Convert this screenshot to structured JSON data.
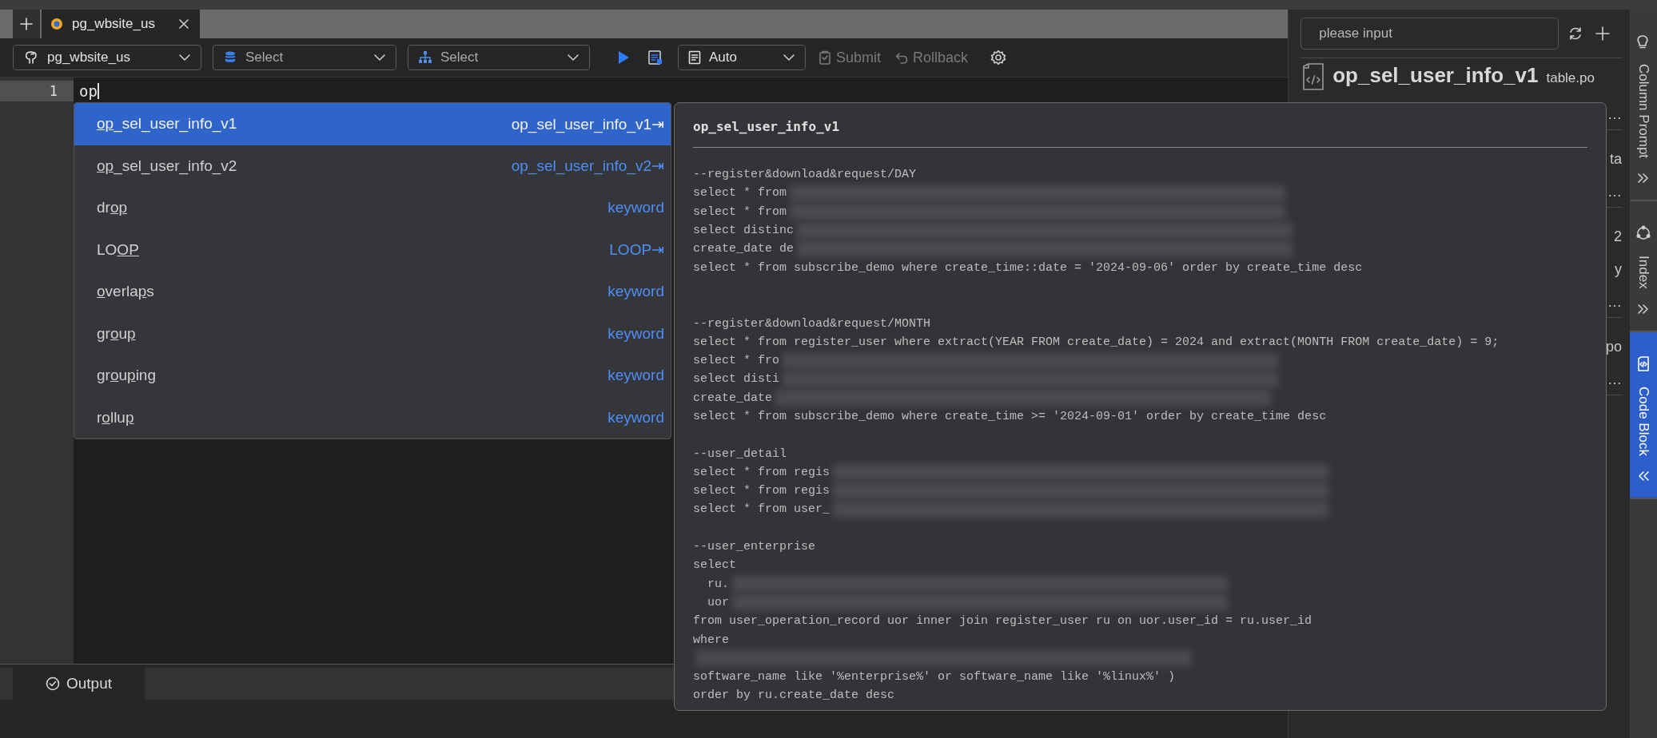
{
  "editor_tab": {
    "title": "pg_wbsite_us",
    "selected": true
  },
  "toolbar": {
    "datasource": "pg_wbsite_us",
    "database": {
      "placeholder": "Select"
    },
    "schema": {
      "placeholder": "Select"
    },
    "mode": "Auto",
    "submit": {
      "label": "Submit",
      "disabled": true
    },
    "rollback": {
      "label": "Rollback",
      "disabled": true
    }
  },
  "editor": {
    "lines": [
      {
        "number": "1",
        "text": "op"
      }
    ]
  },
  "suggestions": [
    {
      "label_parts": [
        {
          "text": "op",
          "matched": true
        },
        {
          "text": "_sel_user_info_v1",
          "matched": false
        }
      ],
      "detail": "op_sel_user_info_v1⇥",
      "selected": true
    },
    {
      "label_parts": [
        {
          "text": "op",
          "matched": true
        },
        {
          "text": "_sel_user_info_v2",
          "matched": false
        }
      ],
      "detail": "op_sel_user_info_v2⇥",
      "selected": false
    },
    {
      "label_parts": [
        {
          "text": "dr",
          "matched": false
        },
        {
          "text": "op",
          "matched": true
        }
      ],
      "detail": "keyword",
      "selected": false
    },
    {
      "label_parts": [
        {
          "text": "LO",
          "matched": false
        },
        {
          "text": "OP",
          "matched": true
        }
      ],
      "detail": "LOOP⇥",
      "selected": false
    },
    {
      "label_parts": [
        {
          "text": "o",
          "matched": true
        },
        {
          "text": "verla",
          "matched": false
        },
        {
          "text": "p",
          "matched": true
        },
        {
          "text": "s",
          "matched": false
        }
      ],
      "detail": "keyword",
      "selected": false
    },
    {
      "label_parts": [
        {
          "text": "gr",
          "matched": false
        },
        {
          "text": "o",
          "matched": true
        },
        {
          "text": "u",
          "matched": false
        },
        {
          "text": "p",
          "matched": true
        }
      ],
      "detail": "keyword",
      "selected": false
    },
    {
      "label_parts": [
        {
          "text": "gr",
          "matched": false
        },
        {
          "text": "o",
          "matched": true
        },
        {
          "text": "u",
          "matched": false
        },
        {
          "text": "p",
          "matched": true
        },
        {
          "text": "ing",
          "matched": false
        }
      ],
      "detail": "keyword",
      "selected": false
    },
    {
      "label_parts": [
        {
          "text": "r",
          "matched": false
        },
        {
          "text": "o",
          "matched": true
        },
        {
          "text": "llu",
          "matched": false
        },
        {
          "text": "p",
          "matched": true
        }
      ],
      "detail": "keyword",
      "selected": false
    }
  ],
  "code_preview": {
    "title": "op_sel_user_info_v1",
    "lines": [
      {
        "kind": "code",
        "text": "--register&download&request/DAY",
        "redacted": false
      },
      {
        "kind": "code",
        "text": "select * from",
        "redacted": true
      },
      {
        "kind": "code",
        "text": "select * from",
        "redacted": true
      },
      {
        "kind": "code",
        "text": "select distinc",
        "redacted": true
      },
      {
        "kind": "code",
        "text": "create_date de",
        "redacted": true
      },
      {
        "kind": "code",
        "text": "select * from subscribe_demo where create_time::date = '2024-09-06' order by create_time desc",
        "redacted": false
      },
      {
        "kind": "blank"
      },
      {
        "kind": "blank"
      },
      {
        "kind": "code",
        "text": "--register&download&request/MONTH",
        "redacted": false
      },
      {
        "kind": "code",
        "text": "select * from register_user where extract(YEAR FROM create_date) = 2024 and extract(MONTH FROM create_date) = 9;",
        "redacted": false
      },
      {
        "kind": "code",
        "text": "select * fro",
        "redacted": true
      },
      {
        "kind": "code",
        "text": "select disti",
        "redacted": true
      },
      {
        "kind": "code",
        "text": "create_date",
        "redacted": true
      },
      {
        "kind": "code",
        "text": "select * from subscribe_demo where create_time >= '2024-09-01' order by create_time desc",
        "redacted": false
      },
      {
        "kind": "blank"
      },
      {
        "kind": "code",
        "text": "--user_detail",
        "redacted": false
      },
      {
        "kind": "code",
        "text": "select * from regis",
        "redacted": true
      },
      {
        "kind": "code",
        "text": "select * from regis",
        "redacted": true
      },
      {
        "kind": "code",
        "text": "select * from user_",
        "redacted": true
      },
      {
        "kind": "blank"
      },
      {
        "kind": "code",
        "text": "--user_enterprise",
        "redacted": false
      },
      {
        "kind": "code",
        "text": "select",
        "redacted": false
      },
      {
        "kind": "code",
        "text": "  ru.",
        "redacted": true
      },
      {
        "kind": "code",
        "text": "  uor",
        "redacted": true
      },
      {
        "kind": "code",
        "text": "from user_operation_record uor inner join register_user ru on uor.user_id = ru.user_id",
        "redacted": false
      },
      {
        "kind": "code",
        "text": "where",
        "redacted": false
      },
      {
        "kind": "code",
        "redacted": true
      },
      {
        "kind": "code",
        "text": "software_name like '%enterprise%' or software_name like '%linux%' )",
        "redacted": false
      },
      {
        "kind": "code",
        "text": "order by ru.create_date desc",
        "redacted": false
      }
    ]
  },
  "output_tab": {
    "label": "Output",
    "selected": true
  },
  "right_panel": {
    "search": {
      "placeholder": "please input"
    },
    "items": [
      {
        "title": "op_sel_user_info_v1",
        "type": "table.po",
        "fragments": [
          "…"
        ]
      },
      {
        "fragments": [
          "ta",
          "…"
        ]
      },
      {
        "fragments": [
          "2",
          "y",
          "…"
        ]
      },
      {
        "fragments": [
          "po",
          "…"
        ]
      }
    ]
  },
  "side_tabs": [
    {
      "label": "Column Prompt",
      "selected": false
    },
    {
      "label": "Index",
      "selected": false
    },
    {
      "label": "Code Block",
      "selected": true
    }
  ]
}
